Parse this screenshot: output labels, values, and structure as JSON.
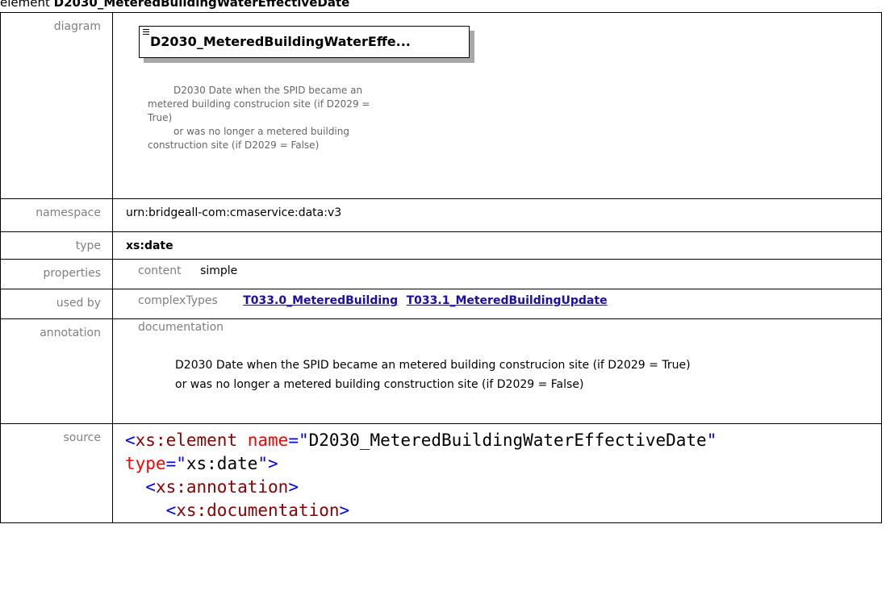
{
  "title": {
    "kind": "element",
    "name": "D2030_MeteredBuildingWaterEffectiveDate"
  },
  "rows": {
    "diagram": {
      "label": "diagram",
      "box_name": "D2030_MeteredBuildingWaterEffe...",
      "doc_line1": "D2030 Date when the SPID became an",
      "doc_line2": "metered building construcion site (if D2029 =",
      "doc_line3": "True)",
      "doc_line4": "or was no longer a metered building",
      "doc_line5": "construction site (if D2029 = False)"
    },
    "namespace": {
      "label": "namespace",
      "value": "urn:bridgeall-com:cmaservice:data:v3"
    },
    "type": {
      "label": "type",
      "value": "xs:date"
    },
    "properties": {
      "label": "properties",
      "key": "content",
      "value": "simple"
    },
    "used_by": {
      "label": "used by",
      "key": "complexTypes",
      "links": [
        "T033.0_MeteredBuilding",
        "T033.1_MeteredBuildingUpdate"
      ]
    },
    "annotation": {
      "label": "annotation",
      "key": "documentation",
      "line1": "D2030 Date when the SPID became an metered building construcion site (if D2029 = True)",
      "line2": "or was no longer a metered building construction site (if D2029 = False)"
    },
    "source": {
      "label": "source",
      "l1_tag": "xs:element",
      "l1_attr": "name",
      "l1_val": "D2030_MeteredBuildingWaterEffectiveDate",
      "l2_attr": "type",
      "l2_val": "xs:date",
      "l3_tag": "xs:annotation",
      "l4_tag": "xs:documentation"
    }
  }
}
